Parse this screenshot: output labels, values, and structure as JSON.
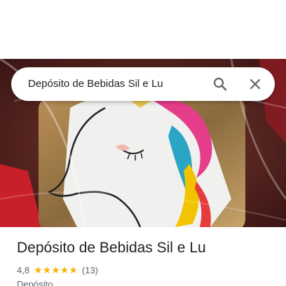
{
  "search": {
    "query": "Depósito de Bebidas Sil e Lu"
  },
  "place": {
    "name": "Depósito de Bebidas Sil e Lu",
    "rating": "4,8",
    "rating_fraction": 0.96,
    "review_count": "(13)",
    "category": "Depósito"
  },
  "icons": {
    "search": "search-icon",
    "close": "close-icon",
    "star": "star-icon"
  },
  "colors": {
    "star": "#f5b400",
    "text_primary": "#202124",
    "text_secondary": "#5f6368"
  }
}
